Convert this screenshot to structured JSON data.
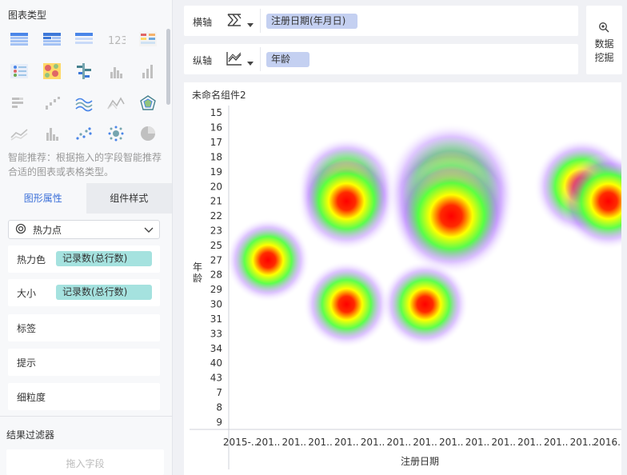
{
  "left_panel": {
    "chart_types_title": "图表类型",
    "recommend_hint": "智能推荐：根据拖入的字段智能推荐合适的图表或表格类型。",
    "tabs": {
      "graph_props": "图形属性",
      "component_style": "组件样式"
    },
    "mark_type": {
      "label": "热力点",
      "icon": "heatmap-icon"
    },
    "props": {
      "heat_color_label": "热力色",
      "heat_color_field": "记录数(总行数)",
      "size_label": "大小",
      "size_field": "记录数(总行数)",
      "label_label": "标签",
      "tooltip_label": "提示",
      "granularity_label": "细粒度"
    },
    "result_filter_title": "结果过滤器",
    "drop_hint": "拖入字段"
  },
  "axes": {
    "x_label": "横轴",
    "x_field": "注册日期(年月日)",
    "y_label": "纵轴",
    "y_field": "年龄"
  },
  "mining_button": {
    "line1": "数据",
    "line2": "挖掘"
  },
  "colors": {
    "accent": "#3b6fd8",
    "pill_blue": "#c4d0f1",
    "pill_teal": "#a5e2df"
  },
  "chart_data": {
    "type": "heatmap",
    "title": "未命名组件2",
    "xlabel": "注册日期",
    "ylabel": "年龄",
    "x_ticks": [
      "2015-…",
      "201..",
      "201..",
      "201..",
      "201..",
      "201..",
      "201..",
      "201..",
      "201..",
      "201..",
      "201..",
      "201..",
      "201..",
      "201..",
      "2016.."
    ],
    "y_ticks": [
      "15",
      "16",
      "17",
      "18",
      "19",
      "20",
      "21",
      "22",
      "23",
      "25",
      "27",
      "28",
      "29",
      "30",
      "31",
      "33",
      "34",
      "40",
      "43",
      "7",
      "8",
      "9"
    ],
    "points": [
      {
        "x": 4,
        "y": 5,
        "value": 22
      },
      {
        "x": 4,
        "y": 6,
        "value": 22
      },
      {
        "x": 8,
        "y": 5,
        "value": 60
      },
      {
        "x": 8,
        "y": 6,
        "value": 60
      },
      {
        "x": 8,
        "y": 7,
        "value": 45
      },
      {
        "x": 13,
        "y": 5,
        "value": 20
      },
      {
        "x": 14,
        "y": 6,
        "value": 20
      },
      {
        "x": 1,
        "y": 10,
        "value": 10
      },
      {
        "x": 4,
        "y": 13,
        "value": 12
      },
      {
        "x": 7,
        "y": 13,
        "value": 12
      }
    ]
  }
}
